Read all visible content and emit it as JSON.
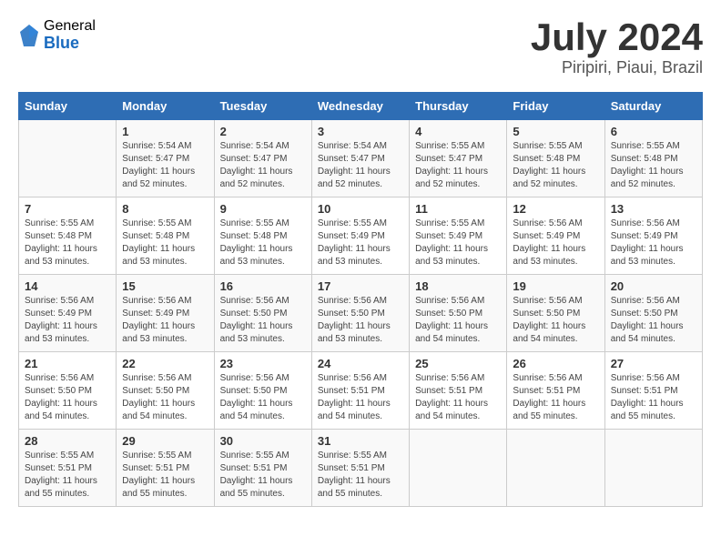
{
  "logo": {
    "general": "General",
    "blue": "Blue"
  },
  "header": {
    "month": "July 2024",
    "location": "Piripiri, Piaui, Brazil"
  },
  "weekdays": [
    "Sunday",
    "Monday",
    "Tuesday",
    "Wednesday",
    "Thursday",
    "Friday",
    "Saturday"
  ],
  "weeks": [
    [
      {
        "day": "",
        "info": ""
      },
      {
        "day": "1",
        "info": "Sunrise: 5:54 AM\nSunset: 5:47 PM\nDaylight: 11 hours\nand 52 minutes."
      },
      {
        "day": "2",
        "info": "Sunrise: 5:54 AM\nSunset: 5:47 PM\nDaylight: 11 hours\nand 52 minutes."
      },
      {
        "day": "3",
        "info": "Sunrise: 5:54 AM\nSunset: 5:47 PM\nDaylight: 11 hours\nand 52 minutes."
      },
      {
        "day": "4",
        "info": "Sunrise: 5:55 AM\nSunset: 5:47 PM\nDaylight: 11 hours\nand 52 minutes."
      },
      {
        "day": "5",
        "info": "Sunrise: 5:55 AM\nSunset: 5:48 PM\nDaylight: 11 hours\nand 52 minutes."
      },
      {
        "day": "6",
        "info": "Sunrise: 5:55 AM\nSunset: 5:48 PM\nDaylight: 11 hours\nand 52 minutes."
      }
    ],
    [
      {
        "day": "7",
        "info": "Sunrise: 5:55 AM\nSunset: 5:48 PM\nDaylight: 11 hours\nand 53 minutes."
      },
      {
        "day": "8",
        "info": "Sunrise: 5:55 AM\nSunset: 5:48 PM\nDaylight: 11 hours\nand 53 minutes."
      },
      {
        "day": "9",
        "info": "Sunrise: 5:55 AM\nSunset: 5:48 PM\nDaylight: 11 hours\nand 53 minutes."
      },
      {
        "day": "10",
        "info": "Sunrise: 5:55 AM\nSunset: 5:49 PM\nDaylight: 11 hours\nand 53 minutes."
      },
      {
        "day": "11",
        "info": "Sunrise: 5:55 AM\nSunset: 5:49 PM\nDaylight: 11 hours\nand 53 minutes."
      },
      {
        "day": "12",
        "info": "Sunrise: 5:56 AM\nSunset: 5:49 PM\nDaylight: 11 hours\nand 53 minutes."
      },
      {
        "day": "13",
        "info": "Sunrise: 5:56 AM\nSunset: 5:49 PM\nDaylight: 11 hours\nand 53 minutes."
      }
    ],
    [
      {
        "day": "14",
        "info": "Sunrise: 5:56 AM\nSunset: 5:49 PM\nDaylight: 11 hours\nand 53 minutes."
      },
      {
        "day": "15",
        "info": "Sunrise: 5:56 AM\nSunset: 5:49 PM\nDaylight: 11 hours\nand 53 minutes."
      },
      {
        "day": "16",
        "info": "Sunrise: 5:56 AM\nSunset: 5:50 PM\nDaylight: 11 hours\nand 53 minutes."
      },
      {
        "day": "17",
        "info": "Sunrise: 5:56 AM\nSunset: 5:50 PM\nDaylight: 11 hours\nand 53 minutes."
      },
      {
        "day": "18",
        "info": "Sunrise: 5:56 AM\nSunset: 5:50 PM\nDaylight: 11 hours\nand 54 minutes."
      },
      {
        "day": "19",
        "info": "Sunrise: 5:56 AM\nSunset: 5:50 PM\nDaylight: 11 hours\nand 54 minutes."
      },
      {
        "day": "20",
        "info": "Sunrise: 5:56 AM\nSunset: 5:50 PM\nDaylight: 11 hours\nand 54 minutes."
      }
    ],
    [
      {
        "day": "21",
        "info": "Sunrise: 5:56 AM\nSunset: 5:50 PM\nDaylight: 11 hours\nand 54 minutes."
      },
      {
        "day": "22",
        "info": "Sunrise: 5:56 AM\nSunset: 5:50 PM\nDaylight: 11 hours\nand 54 minutes."
      },
      {
        "day": "23",
        "info": "Sunrise: 5:56 AM\nSunset: 5:50 PM\nDaylight: 11 hours\nand 54 minutes."
      },
      {
        "day": "24",
        "info": "Sunrise: 5:56 AM\nSunset: 5:51 PM\nDaylight: 11 hours\nand 54 minutes."
      },
      {
        "day": "25",
        "info": "Sunrise: 5:56 AM\nSunset: 5:51 PM\nDaylight: 11 hours\nand 54 minutes."
      },
      {
        "day": "26",
        "info": "Sunrise: 5:56 AM\nSunset: 5:51 PM\nDaylight: 11 hours\nand 55 minutes."
      },
      {
        "day": "27",
        "info": "Sunrise: 5:56 AM\nSunset: 5:51 PM\nDaylight: 11 hours\nand 55 minutes."
      }
    ],
    [
      {
        "day": "28",
        "info": "Sunrise: 5:55 AM\nSunset: 5:51 PM\nDaylight: 11 hours\nand 55 minutes."
      },
      {
        "day": "29",
        "info": "Sunrise: 5:55 AM\nSunset: 5:51 PM\nDaylight: 11 hours\nand 55 minutes."
      },
      {
        "day": "30",
        "info": "Sunrise: 5:55 AM\nSunset: 5:51 PM\nDaylight: 11 hours\nand 55 minutes."
      },
      {
        "day": "31",
        "info": "Sunrise: 5:55 AM\nSunset: 5:51 PM\nDaylight: 11 hours\nand 55 minutes."
      },
      {
        "day": "",
        "info": ""
      },
      {
        "day": "",
        "info": ""
      },
      {
        "day": "",
        "info": ""
      }
    ]
  ]
}
